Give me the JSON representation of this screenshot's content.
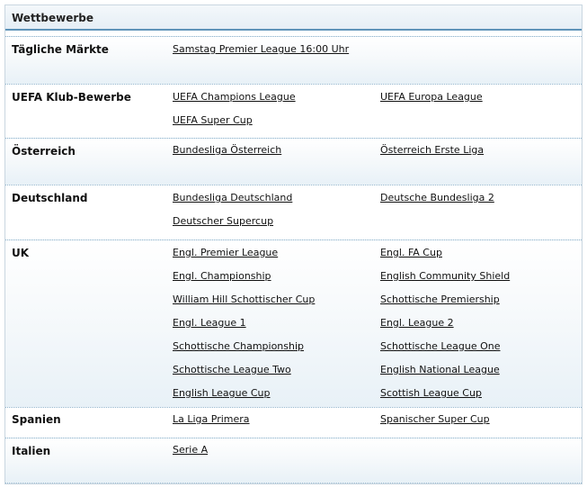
{
  "header": {
    "title": "Wettbewerbe"
  },
  "sections": [
    {
      "label": "Tägliche Märkte",
      "links": [
        "Samstag Premier League 16:00 Uhr"
      ]
    },
    {
      "label": "UEFA Klub-Bewerbe",
      "links": [
        "UEFA Champions League",
        "UEFA Europa League",
        "UEFA Super Cup"
      ]
    },
    {
      "label": "Österreich",
      "links": [
        "Bundesliga Österreich",
        "Österreich Erste Liga"
      ]
    },
    {
      "label": "Deutschland",
      "links": [
        "Bundesliga Deutschland",
        "Deutsche Bundesliga 2",
        "Deutscher Supercup"
      ]
    },
    {
      "label": "UK",
      "links": [
        "Engl. Premier League",
        "Engl. FA Cup",
        "Engl. Championship",
        "English Community Shield",
        "William Hill Schottischer Cup",
        "Schottische Premiership",
        "Engl. League 1",
        "Engl. League 2",
        "Schottische Championship",
        "Schottische League One",
        "Schottische League Two",
        "English National League",
        "English League Cup",
        "Scottish League Cup"
      ]
    },
    {
      "label": "Spanien",
      "links": [
        "La Liga Primera",
        "Spanischer Super Cup"
      ]
    },
    {
      "label": "Italien",
      "links": [
        "Serie A"
      ]
    }
  ]
}
